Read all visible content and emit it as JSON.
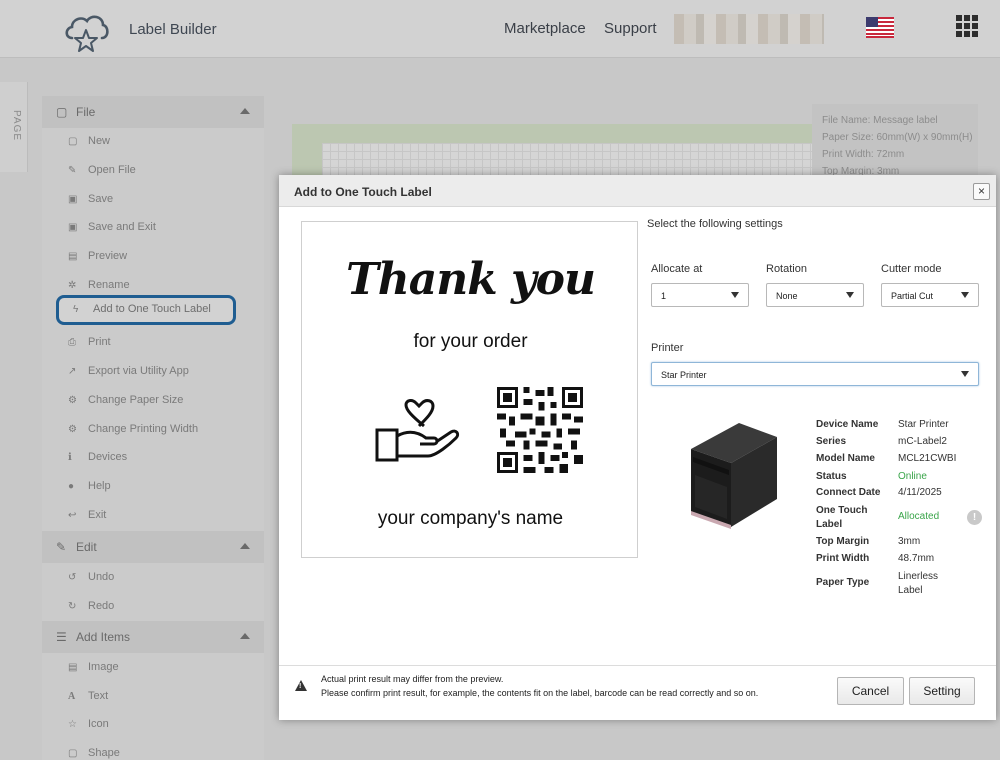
{
  "header": {
    "brand": "Label Builder",
    "nav": [
      "Marketplace",
      "Support"
    ],
    "language_flag": "us-flag-icon",
    "apps_icon": "grid-icon"
  },
  "page_tab": {
    "label": "PAGE"
  },
  "menu": {
    "file": {
      "title": "File",
      "items": [
        "New",
        "Open File",
        "Save",
        "Save and Exit",
        "Preview",
        "Rename",
        "Add to One Touch Label",
        "Print",
        "Export via Utility App",
        "Change Paper Size",
        "Change Printing Width",
        "Devices",
        "Help",
        "Exit"
      ]
    },
    "edit": {
      "title": "Edit",
      "items": [
        "Undo",
        "Redo"
      ]
    },
    "add_items": {
      "title": "Add Items",
      "items": [
        "Image",
        "Text",
        "Icon",
        "Shape"
      ]
    }
  },
  "file_info": {
    "name": "File Name: Message label",
    "paper_size": "Paper Size: 60mm(W) x 90mm(H)",
    "print_width": "Print Width: 72mm",
    "top_margin": "Top Margin: 3mm"
  },
  "modal": {
    "title": "Add to One Touch Label",
    "close": "×",
    "preview": {
      "headline": "Thank you",
      "subline": "for your order",
      "company": "your company's name"
    },
    "settings_prompt": "Select the following settings",
    "allocate": {
      "label": "Allocate at",
      "value": "1"
    },
    "rotation": {
      "label": "Rotation",
      "value": "None"
    },
    "cutter": {
      "label": "Cutter mode",
      "value": "Partial Cut"
    },
    "printer": {
      "label": "Printer",
      "value": "Star Printer"
    },
    "details": {
      "device_name_k": "Device Name",
      "device_name_v": "Star Printer",
      "series_k": "Series",
      "series_v": "mC-Label2",
      "model_k": "Model Name",
      "model_v": "MCL21CWBI",
      "status_k": "Status",
      "status_v": "Online",
      "connect_k": "Connect Date",
      "connect_v": "4/11/2025",
      "otl_k": "One Touch Label",
      "otl_v": "Allocated",
      "margin_k": "Top Margin",
      "margin_v": "3mm",
      "width_k": "Print Width",
      "width_v": "48.7mm",
      "paper_k": "Paper Type",
      "paper_v": "Linerless Label"
    },
    "info_glyph": "!",
    "footer": {
      "note1": "Actual print result may differ from the preview.",
      "note2": "Please confirm print result, for example, the contents fit on the label, barcode can be read correctly and so on.",
      "cancel": "Cancel",
      "setting": "Setting"
    }
  },
  "colors": {
    "accent_ring": "#1f5d91",
    "status_green": "#3aa54a"
  }
}
